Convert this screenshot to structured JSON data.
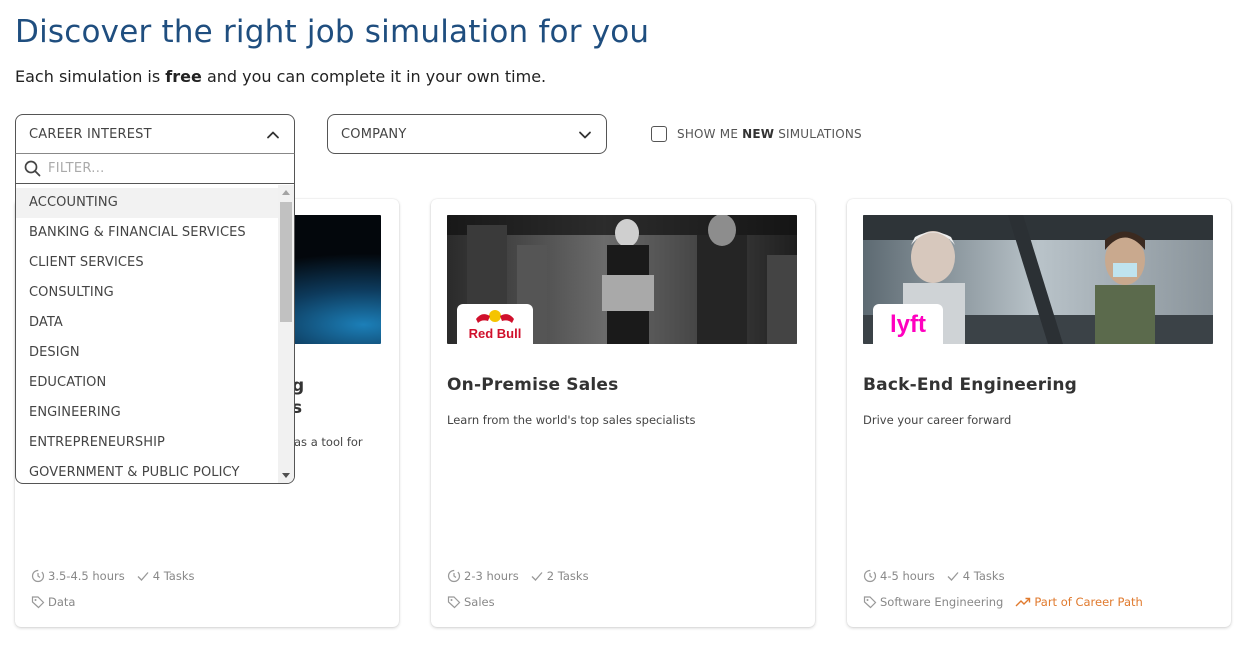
{
  "header": {
    "title": "Discover the right job simulation for you",
    "subtitle_before": "Each simulation is ",
    "subtitle_bold": "free",
    "subtitle_after": " and you can complete it in your own time."
  },
  "filters": {
    "career_interest": {
      "label": "CAREER INTEREST",
      "expanded": true
    },
    "company": {
      "label": "COMPANY"
    },
    "new_sims": {
      "before": "SHOW ME",
      "bold": "NEW",
      "after": "SIMULATIONS",
      "checked": false
    },
    "filter_input_placeholder": "FILTER...",
    "options": [
      "ACCOUNTING",
      "BANKING & FINANCIAL SERVICES",
      "CLIENT SERVICES",
      "CONSULTING",
      "DATA",
      "DESIGN",
      "EDUCATION",
      "ENGINEERING",
      "ENTREPRENEURSHIP",
      "GOVERNMENT & PUBLIC POLICY"
    ]
  },
  "cards": [
    {
      "title_fragment_1": "g",
      "title_fragment_2": "s",
      "desc_fragment": "as a tool for",
      "duration": "3.5-4.5 hours",
      "tasks": "4 Tasks",
      "tag": "Data"
    },
    {
      "title": "On-Premise Sales",
      "desc": "Learn from the world's top sales specialists",
      "logo": "Red Bull",
      "duration": "2-3 hours",
      "tasks": "2 Tasks",
      "tag": "Sales"
    },
    {
      "title": "Back-End Engineering",
      "desc": "Drive your career forward",
      "logo": "lyft",
      "duration": "4-5 hours",
      "tasks": "4 Tasks",
      "tag": "Software Engineering",
      "career_path": "Part of Career Path"
    }
  ],
  "colors": {
    "title_blue": "#1f4e7f",
    "career_path_orange": "#e07a2e",
    "lyft_pink": "#ff00bf",
    "redbull_red": "#d0102c"
  }
}
